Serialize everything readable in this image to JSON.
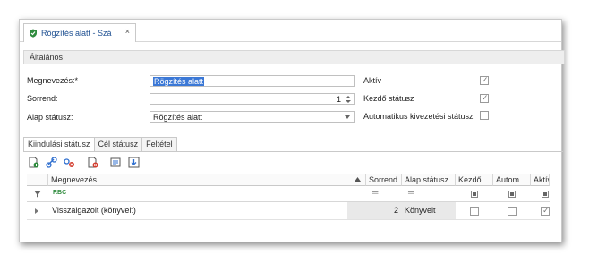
{
  "tab": {
    "title": "Rögzítés alatt - Szá",
    "close": "×",
    "icon": "shield-icon"
  },
  "group": {
    "label": "Általános"
  },
  "form": {
    "name_label": "Megnevezés:*",
    "name_value": "Rögzítés alatt",
    "order_label": "Sorrend:",
    "order_value": "1",
    "base_status_label": "Alap státusz:",
    "base_status_value": "Rögzítés alatt",
    "active_label": "Aktív",
    "active_checked": true,
    "start_status_label": "Kezdő státusz",
    "start_status_checked": true,
    "auto_label": "Automatikus kivezetési státusz",
    "auto_checked": false
  },
  "subtabs": [
    "Kiindulási státusz",
    "Cél státusz",
    "Feltétel"
  ],
  "toolbar": [
    "add-icon",
    "link-icon",
    "unlink-icon",
    "delete-icon",
    "edit-icon",
    "export-icon"
  ],
  "grid": {
    "columns": [
      "Megnevezés",
      "Sorrend",
      "Alap státusz",
      "Kezdő ...",
      "Autom...",
      "Aktív"
    ],
    "filter_text": "RBC",
    "rows": [
      {
        "name": "Visszaigazolt (könyvelt)",
        "order": "2",
        "base_status": "Könyvelt",
        "start": false,
        "auto": false,
        "active": true
      }
    ]
  },
  "colors": {
    "accent": "#3b78d6",
    "tab_text": "#1d4f91",
    "icon_green": "#2e8b3d",
    "icon_red": "#d33b2c",
    "icon_blue": "#2f6fcf"
  }
}
